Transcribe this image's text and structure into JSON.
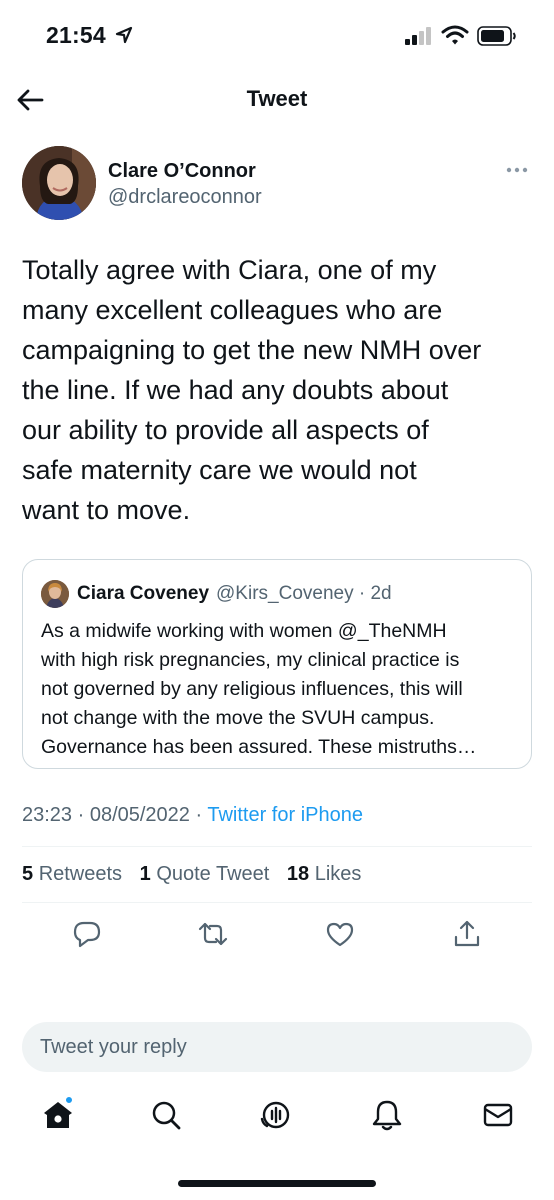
{
  "status_bar": {
    "time": "21:54",
    "icons": [
      "location-arrow-icon",
      "cellular-signal-icon",
      "wifi-icon",
      "battery-icon"
    ]
  },
  "header": {
    "title": "Tweet",
    "back_icon": "arrow-left-icon"
  },
  "tweet": {
    "author": {
      "name": "Clare O’Connor",
      "handle": "@drclareoconnor"
    },
    "more_icon": "more-dots-icon",
    "text": "Totally agree with Ciara, one of my\nmany excellent colleagues who are\ncampaigning to get the new NMH over\nthe line. If we had any doubts about\nour ability to provide all aspects of\nsafe maternity care we would not\nwant to move.",
    "quote": {
      "name": "Ciara Coveney",
      "handle": "@Kirs_Coveney · 2d",
      "text": "As a midwife working with women @_TheNMH\nwith high risk pregnancies, my clinical practice is\nnot governed by any religious influences, this will\nnot change with the move the SVUH campus.\nGovernance has been assured. These mistruths…"
    },
    "meta": {
      "time_date": "23:23 · 08/05/2022 ·",
      "source": "Twitter for iPhone"
    },
    "stats": {
      "retweets_count": "5",
      "retweets_label": "Retweets",
      "quotes_count": "1",
      "quotes_label": "Quote Tweet",
      "likes_count": "18",
      "likes_label": "Likes"
    },
    "actions": [
      "reply-icon",
      "retweet-icon",
      "like-heart-icon",
      "share-icon"
    ]
  },
  "reply": {
    "placeholder": "Tweet your reply"
  },
  "tabbar": {
    "items": [
      "home-icon",
      "search-icon",
      "spaces-icon",
      "notifications-bell-icon",
      "messages-icon"
    ],
    "accent_color": "#1d9bf0"
  },
  "colors": {
    "text": "#0f1419",
    "secondary": "#536471",
    "link": "#1d9bf0",
    "border": "#cfd9de"
  }
}
